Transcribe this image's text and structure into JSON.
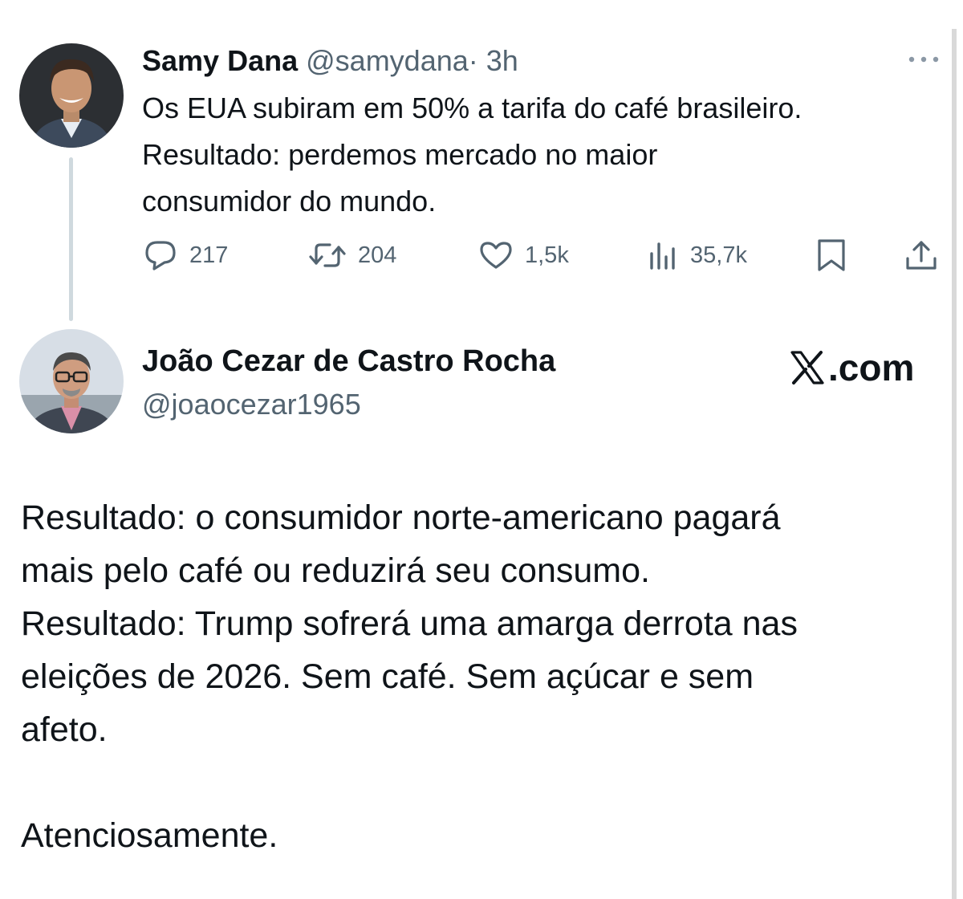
{
  "tweet": {
    "author_name": "Samy Dana",
    "author_handle": "@samydana",
    "separator": "·",
    "time": "3h",
    "text_lines": [
      "Os EUA subiram em 50% a tarifa do café brasileiro.",
      "Resultado: perdemos mercado no maior",
      "consumidor do mundo."
    ],
    "actions": {
      "replies": "217",
      "reposts": "204",
      "likes": "1,5k",
      "views": "35,7k"
    },
    "icons": {
      "more": "more-horizontal-icon",
      "reply": "reply-bubble-icon",
      "repost": "repost-arrows-icon",
      "like": "heart-icon",
      "views": "views-bar-chart-icon",
      "bookmark": "bookmark-icon",
      "share": "share-upload-icon"
    }
  },
  "quote": {
    "author_name": "João Cezar de Castro Rocha",
    "author_handle": "@joaocezar1965",
    "brand": ".com",
    "text_lines": [
      "Resultado: o consumidor norte-americano pagará",
      "mais pelo café ou reduzirá seu consumo.",
      "Resultado: Trump sofrerá uma amarga derrota nas",
      "eleições de 2026. Sem café. Sem açúcar e sem",
      "afeto.",
      "",
      "Atenciosamente."
    ]
  },
  "colors": {
    "text_primary": "#0f1419",
    "text_secondary": "#536471",
    "thread_line": "#cfd9de"
  }
}
